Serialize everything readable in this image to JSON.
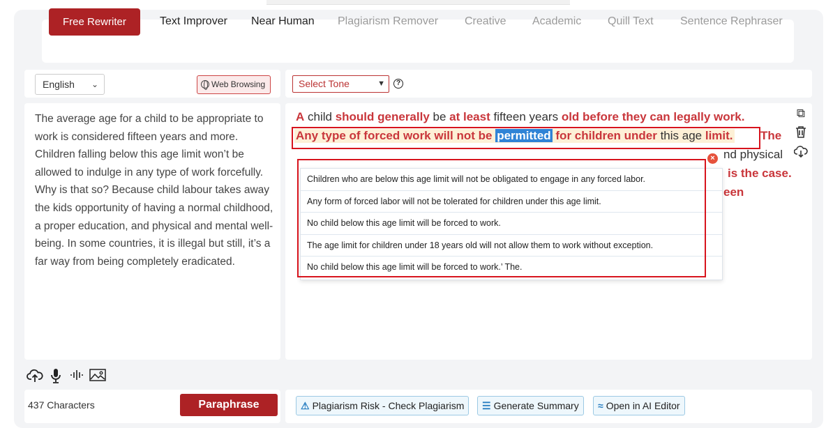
{
  "tabs": [
    {
      "label": "Free Rewriter",
      "active": true
    },
    {
      "label": "Text Improver"
    },
    {
      "label": "Near Human"
    },
    {
      "label": "Plagiarism Remover"
    },
    {
      "label": "Creative"
    },
    {
      "label": "Academic"
    },
    {
      "label": "Quill Text"
    },
    {
      "label": "Sentence Rephraser"
    }
  ],
  "input": {
    "language": "English",
    "web_browsing": "Web Browsing",
    "text": "The average age for a child to be appropriate to work is considered fifteen years and more. Children falling below this age limit won’t be allowed to indulge in any type of work forcefully. Why is that so? Because child labour takes away the kids opportunity of having a normal childhood, a proper education, and physical and mental well-being. In some countries, it is illegal but still, it’s a far way from being completely eradicated.",
    "char_count": "437 Characters",
    "paraphrase_label": "Paraphrase"
  },
  "output": {
    "tone_label": "Select Tone",
    "help": "?",
    "line1": [
      {
        "t": "A",
        "r": true
      },
      {
        "t": " child ",
        "r": false
      },
      {
        "t": "should generally",
        "r": true
      },
      {
        "t": " be ",
        "r": false
      },
      {
        "t": "at least",
        "r": true
      },
      {
        "t": " fifteen years ",
        "r": false
      },
      {
        "t": "old before they can legally work.",
        "r": true
      }
    ],
    "line2_pre": "Any type of forced work will not be ",
    "line2_hl": "permitted",
    "line2_mid": " for children under",
    "line2_plain": " this age ",
    "line2_end": "limit.",
    "line2_tail": " The",
    "line3_visible": "nd physical",
    "line4_visible": "is the case.",
    "line5_visible": "een",
    "suggestions": [
      "Children who are below this age limit will not be obligated to engage in any forced labor.",
      "Any form of forced labor will not be tolerated for children under this age limit.",
      "No child below this age limit will be forced to work.",
      "The age limit for children under 18 years old will not allow them to work without exception.",
      "No child below this age limit will be forced to work.’ The."
    ]
  },
  "actions": {
    "plagiarism": "Plagiarism Risk - Check Plagiarism",
    "summary": "Generate Summary",
    "ai_editor": "Open in AI Editor"
  },
  "colors": {
    "brand_red": "#ad2225",
    "changed_text": "#c9363b",
    "highlight_blue": "#2f83d6",
    "action_blue": "#2a7fc1"
  }
}
